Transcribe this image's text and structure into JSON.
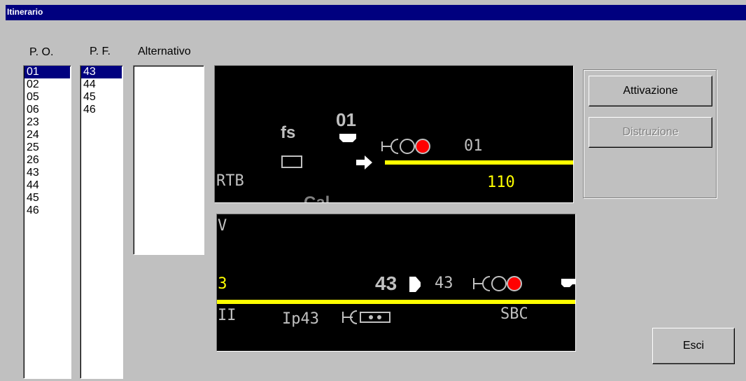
{
  "window": {
    "title": "Itinerario"
  },
  "columns": {
    "po": "P. O.",
    "pf": "P. F.",
    "alt": "Alternativo"
  },
  "po_list": {
    "items": [
      "01",
      "02",
      "05",
      "06",
      "23",
      "24",
      "25",
      "26",
      "43",
      "44",
      "45",
      "46"
    ],
    "selected": "01"
  },
  "pf_list": {
    "items": [
      "43",
      "44",
      "45",
      "46"
    ],
    "selected": "43"
  },
  "alt_list": {
    "items": []
  },
  "buttons": {
    "attivazione": "Attivazione",
    "distruzione": "Distruzione",
    "esci": "Esci"
  },
  "panel_top": {
    "fs_label": "fs",
    "signal_number": "01",
    "signal_label": "01",
    "rtb_label": "RTB",
    "speed_label": "110",
    "partial_label": "Cal..."
  },
  "panel_bottom": {
    "v_label": "V",
    "track_number": "03",
    "signal_number": "43",
    "signal_label": "43",
    "ii_label": "II",
    "ip_label": "Ip43",
    "sbc_label": "SBC"
  },
  "colors": {
    "track": "#ffff00",
    "signal_red": "#ff0000",
    "titlebar": "#00007f",
    "panel_bg": "#000000",
    "text_gray": "#c0c0c0",
    "text_yellow": "#ffff00"
  }
}
